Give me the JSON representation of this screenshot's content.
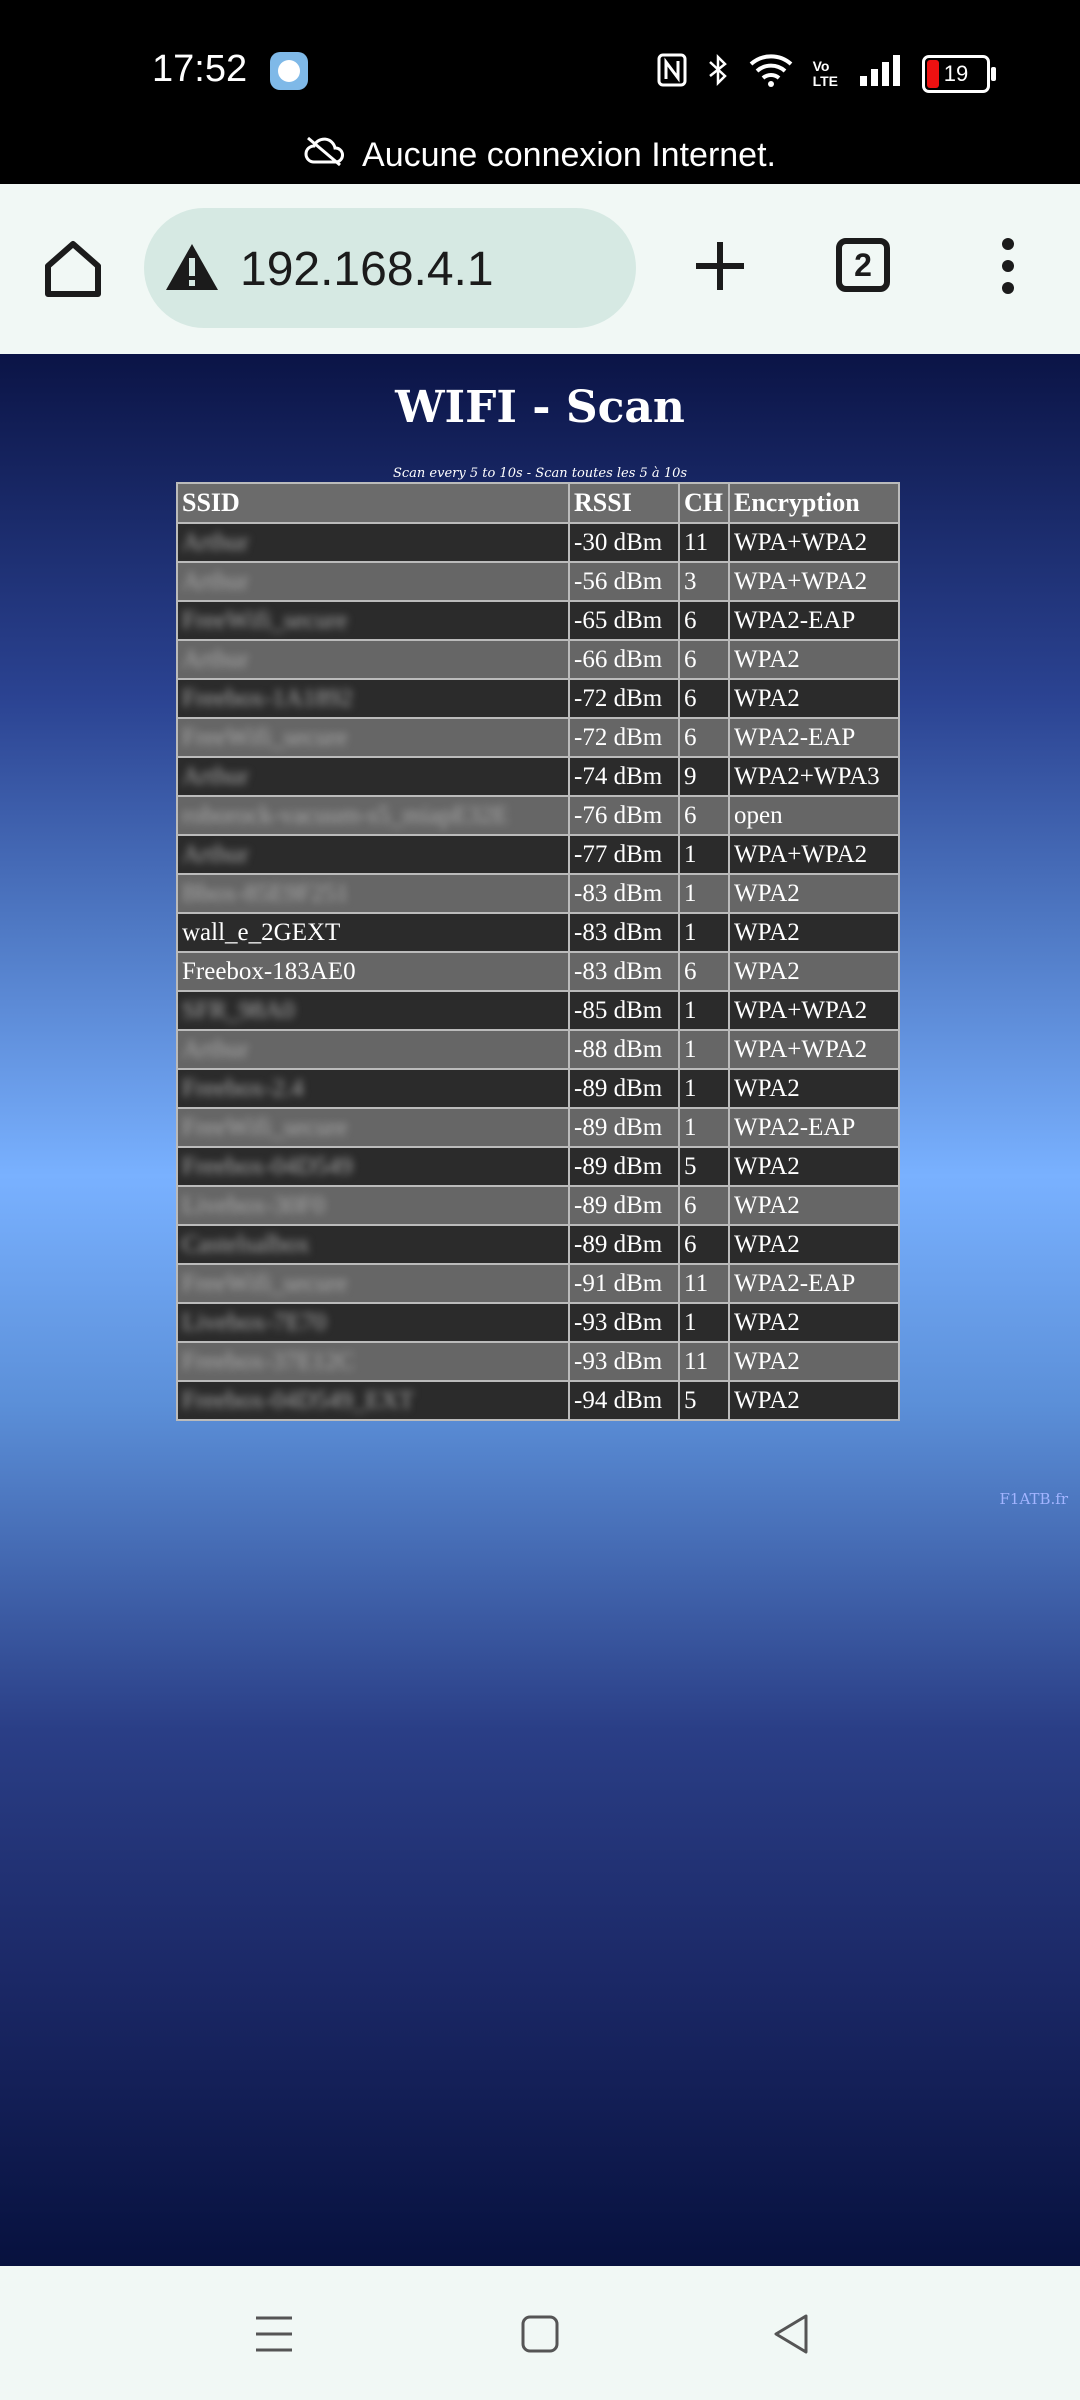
{
  "status_bar": {
    "time": "17:52",
    "battery": "19",
    "icons": [
      "app-notification-icon",
      "nfc-icon",
      "bluetooth-icon",
      "wifi-icon",
      "volte-icon",
      "signal-icon",
      "battery-icon"
    ]
  },
  "network_notice": "Aucune connexion Internet.",
  "browser": {
    "url": "192.168.4.1",
    "tab_count": "2"
  },
  "page": {
    "title": "WIFI - Scan",
    "subtitle": "Scan every 5 to 10s - Scan toutes les 5 à 10s",
    "credit": "F1ATB.fr",
    "headers": [
      "SSID",
      "RSSI",
      "CH",
      "Encryption"
    ],
    "rows": [
      {
        "ssid": "Arthur",
        "rssi": "-30 dBm",
        "ch": "11",
        "enc": "WPA+WPA2"
      },
      {
        "ssid": "Arthur",
        "rssi": "-56 dBm",
        "ch": "3",
        "enc": "WPA+WPA2"
      },
      {
        "ssid": "FreeWifi_secure",
        "rssi": "-65 dBm",
        "ch": "6",
        "enc": "WPA2-EAP"
      },
      {
        "ssid": "Arthur",
        "rssi": "-66 dBm",
        "ch": "6",
        "enc": "WPA2"
      },
      {
        "ssid": "Freebox-1A1892",
        "rssi": "-72 dBm",
        "ch": "6",
        "enc": "WPA2"
      },
      {
        "ssid": "FreeWifi_secure",
        "rssi": "-72 dBm",
        "ch": "6",
        "enc": "WPA2-EAP"
      },
      {
        "ssid": "Arthur",
        "rssi": "-74 dBm",
        "ch": "9",
        "enc": "WPA2+WPA3"
      },
      {
        "ssid": "roborock-vacuum-s5_miapE32E",
        "rssi": "-76 dBm",
        "ch": "6",
        "enc": "open"
      },
      {
        "ssid": "Arthur",
        "rssi": "-77 dBm",
        "ch": "1",
        "enc": "WPA+WPA2"
      },
      {
        "ssid": "Bbox-85E9F251",
        "rssi": "-83 dBm",
        "ch": "1",
        "enc": "WPA2"
      },
      {
        "ssid": "wall_e_2GEXT",
        "rssi": "-83 dBm",
        "ch": "1",
        "enc": "WPA2"
      },
      {
        "ssid": "Freebox-183AE0",
        "rssi": "-83 dBm",
        "ch": "6",
        "enc": "WPA2"
      },
      {
        "ssid": "SFR_98A0",
        "rssi": "-85 dBm",
        "ch": "1",
        "enc": "WPA+WPA2"
      },
      {
        "ssid": "Arthur",
        "rssi": "-88 dBm",
        "ch": "1",
        "enc": "WPA+WPA2"
      },
      {
        "ssid": "Freebox-2.4",
        "rssi": "-89 dBm",
        "ch": "1",
        "enc": "WPA2"
      },
      {
        "ssid": "FreeWifi_secure",
        "rssi": "-89 dBm",
        "ch": "1",
        "enc": "WPA2-EAP"
      },
      {
        "ssid": "Freebox-04D549",
        "rssi": "-89 dBm",
        "ch": "5",
        "enc": "WPA2"
      },
      {
        "ssid": "Livebox-30F0",
        "rssi": "-89 dBm",
        "ch": "6",
        "enc": "WPA2"
      },
      {
        "ssid": "Castelsalbox",
        "rssi": "-89 dBm",
        "ch": "6",
        "enc": "WPA2"
      },
      {
        "ssid": "FreeWifi_secure",
        "rssi": "-91 dBm",
        "ch": "11",
        "enc": "WPA2-EAP"
      },
      {
        "ssid": "Livebox-7E70",
        "rssi": "-93 dBm",
        "ch": "1",
        "enc": "WPA2"
      },
      {
        "ssid": "Freebox-37E12C",
        "rssi": "-93 dBm",
        "ch": "11",
        "enc": "WPA2"
      },
      {
        "ssid": "Freebox-04D549_EXT",
        "rssi": "-94 dBm",
        "ch": "5",
        "enc": "WPA2"
      }
    ]
  },
  "nav_bar": {
    "icons": [
      "recents-icon",
      "home-icon",
      "back-icon"
    ]
  }
}
